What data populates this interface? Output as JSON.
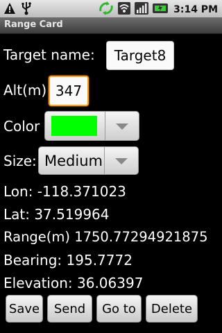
{
  "status_bar": {
    "time": "3:14 PM",
    "icons": [
      "warning-icon",
      "usb-icon",
      "sync-icon",
      "wifi-icon",
      "signal-icon",
      "battery-icon"
    ]
  },
  "title_bar": {
    "title": "Range Card"
  },
  "form": {
    "target_name_label": "Target name:",
    "target_name_value": "Target8",
    "alt_label": "Alt(m)",
    "alt_value": "347",
    "color_label": "Color",
    "color_value": "#00ff00",
    "size_label": "Size:",
    "size_value": "Medium"
  },
  "info": {
    "lon": "Lon: -118.371023",
    "lat": "Lat: 37.519964",
    "range": "Range(m) 1750.77294921875",
    "bearing": "Bearing: 195.7772",
    "elevation": "Elevation: 36.06397"
  },
  "buttons": {
    "save": "Save",
    "send": "Send",
    "goto": "Go to",
    "delete": "Delete"
  }
}
